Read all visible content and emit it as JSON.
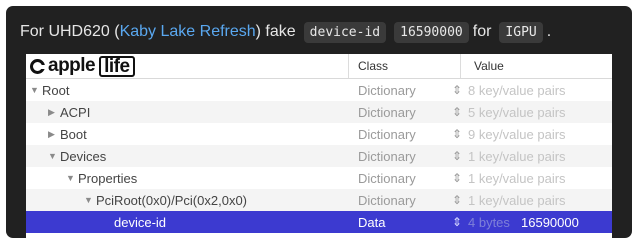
{
  "caption": {
    "prefix": "For UHD620 (",
    "link": "Kaby Lake Refresh",
    "middle": ") fake",
    "code_key": "device-id",
    "code_value": "16590000",
    "for_word": "for",
    "code_target": "IGPU",
    "suffix": ".",
    "colors": {
      "link": "#5aa8f0",
      "code_bg": "#3a3a3a"
    }
  },
  "logo": {
    "word1": "apple",
    "word2": "life",
    "icon": "apple-life-logo-icon"
  },
  "columns": {
    "class": "Class",
    "value": "Value"
  },
  "icons": {
    "expanded": "▼",
    "collapsed": "▶",
    "stepper": "⇕"
  },
  "rows": [
    {
      "key": "Root",
      "disclosure": "expanded",
      "class": "Dictionary",
      "value": "8 key/value pairs"
    },
    {
      "key": "ACPI",
      "disclosure": "collapsed",
      "class": "Dictionary",
      "value": "5 key/value pairs"
    },
    {
      "key": "Boot",
      "disclosure": "collapsed",
      "class": "Dictionary",
      "value": "9 key/value pairs"
    },
    {
      "key": "Devices",
      "disclosure": "expanded",
      "class": "Dictionary",
      "value": "1 key/value pairs"
    },
    {
      "key": "Properties",
      "disclosure": "expanded",
      "class": "Dictionary",
      "value": "1 key/value pairs"
    },
    {
      "key": "PciRoot(0x0)/Pci(0x2,0x0)",
      "disclosure": "expanded",
      "class": "Dictionary",
      "value": "1 key/value pairs"
    },
    {
      "key": "device-id",
      "disclosure": "",
      "class": "Data",
      "value": "4 bytes",
      "value_data": "16590000",
      "selected": true
    }
  ],
  "selection_color": "#3c3ad0"
}
